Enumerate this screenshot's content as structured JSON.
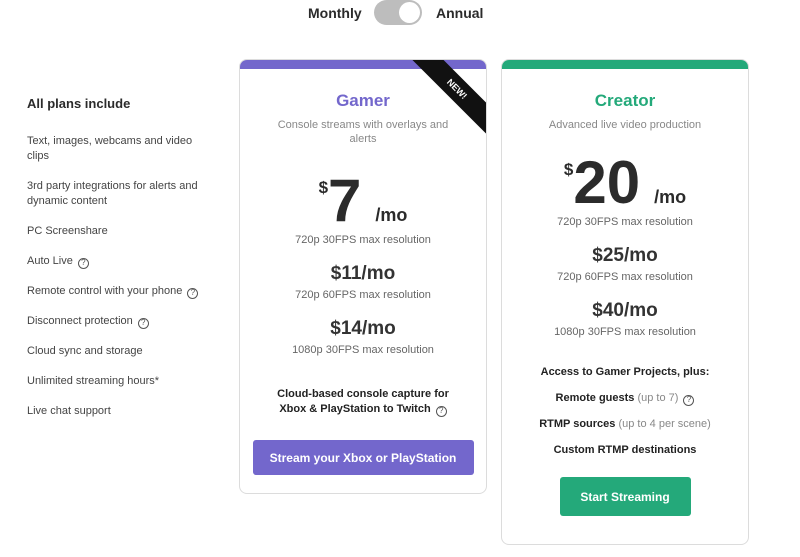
{
  "billing_toggle": {
    "left_label": "Monthly",
    "right_label": "Annual",
    "selected": "Annual"
  },
  "sidebar": {
    "title": "All plans include",
    "items": [
      {
        "label": "Text, images, webcams and video clips",
        "help": false
      },
      {
        "label": "3rd party integrations for alerts and dynamic content",
        "help": false
      },
      {
        "label": "PC Screenshare",
        "help": false
      },
      {
        "label": "Auto Live",
        "help": true
      },
      {
        "label": "Remote control with your phone",
        "help": true
      },
      {
        "label": "Disconnect protection",
        "help": true
      },
      {
        "label": "Cloud sync and storage",
        "help": false
      },
      {
        "label": "Unlimited streaming hours*",
        "help": false
      },
      {
        "label": "Live chat support",
        "help": false
      }
    ]
  },
  "icons": {
    "help": "?"
  },
  "plans": {
    "gamer": {
      "name": "Gamer",
      "ribbon": "NEW!",
      "description": "Console streams with overlays and alerts",
      "accent": "#7367cc",
      "main_price": {
        "currency": "$",
        "amount": "7",
        "period": "/mo",
        "resolution": "720p 30FPS max resolution"
      },
      "tiers": [
        {
          "price": "$11/mo",
          "resolution": "720p 60FPS max resolution"
        },
        {
          "price": "$14/mo",
          "resolution": "1080p 30FPS max resolution"
        }
      ],
      "feature": "Cloud-based console capture for Xbox & PlayStation to Twitch",
      "cta": "Stream your Xbox or PlayStation"
    },
    "creator": {
      "name": "Creator",
      "description": "Advanced live video production",
      "accent": "#24a97a",
      "main_price": {
        "currency": "$",
        "amount": "20",
        "period": "/mo",
        "resolution": "720p 30FPS max resolution"
      },
      "tiers": [
        {
          "price": "$25/mo",
          "resolution": "720p 60FPS max resolution"
        },
        {
          "price": "$40/mo",
          "resolution": "1080p 30FPS max resolution"
        }
      ],
      "features": [
        {
          "label": "Access to Gamer Projects, plus:",
          "note": ""
        },
        {
          "label": "Remote guests",
          "note": "(up to 7)"
        },
        {
          "label": "RTMP sources",
          "note": "(up to 4 per scene)"
        },
        {
          "label": "Custom RTMP destinations",
          "note": ""
        }
      ],
      "cta": "Start Streaming"
    }
  }
}
